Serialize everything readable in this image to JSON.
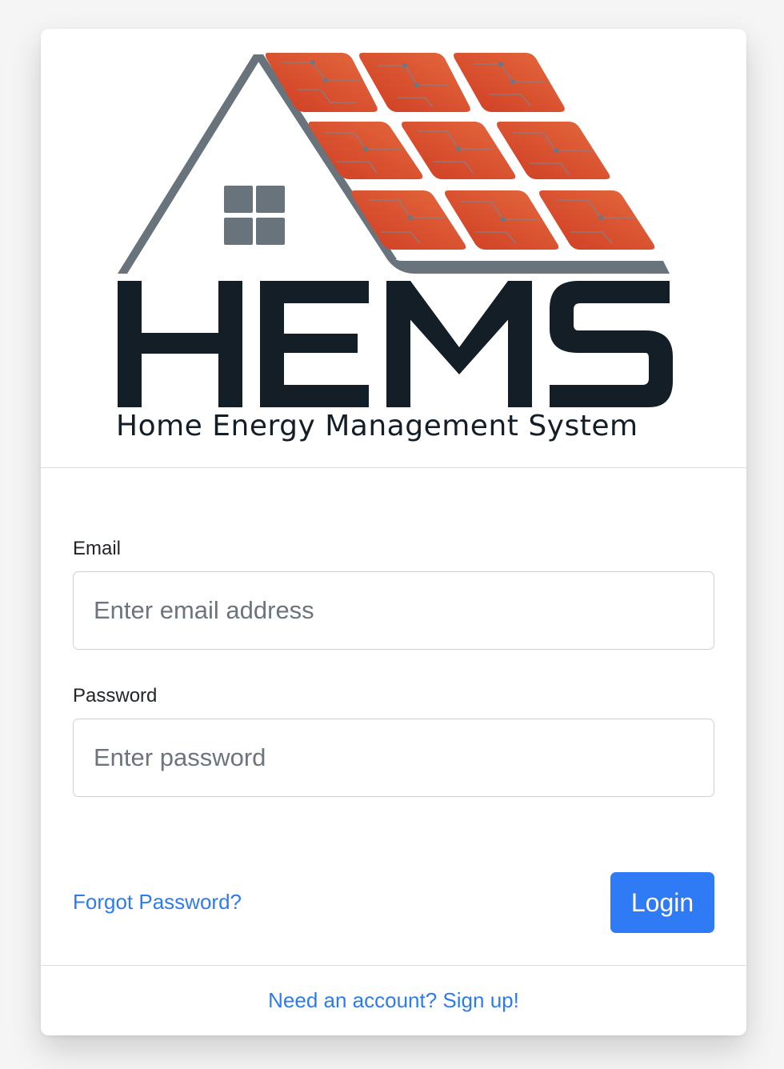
{
  "logo": {
    "wordmark": "HEMS",
    "subtitle": "Home Energy Management System",
    "colors": {
      "roof": "#68737c",
      "panel": "#d7472a",
      "panel_light": "#e2653c",
      "circuit": "#6b7784",
      "text": "#141e26"
    }
  },
  "form": {
    "email": {
      "label": "Email",
      "placeholder": "Enter email address",
      "value": ""
    },
    "password": {
      "label": "Password",
      "placeholder": "Enter password",
      "value": ""
    },
    "forgot_link": "Forgot Password?",
    "login_button": "Login"
  },
  "footer": {
    "signup_link": "Need an account? Sign up!"
  },
  "colors": {
    "accent": "#2f7bf5",
    "link": "#2e7bf0",
    "border": "#cdd1d5"
  }
}
